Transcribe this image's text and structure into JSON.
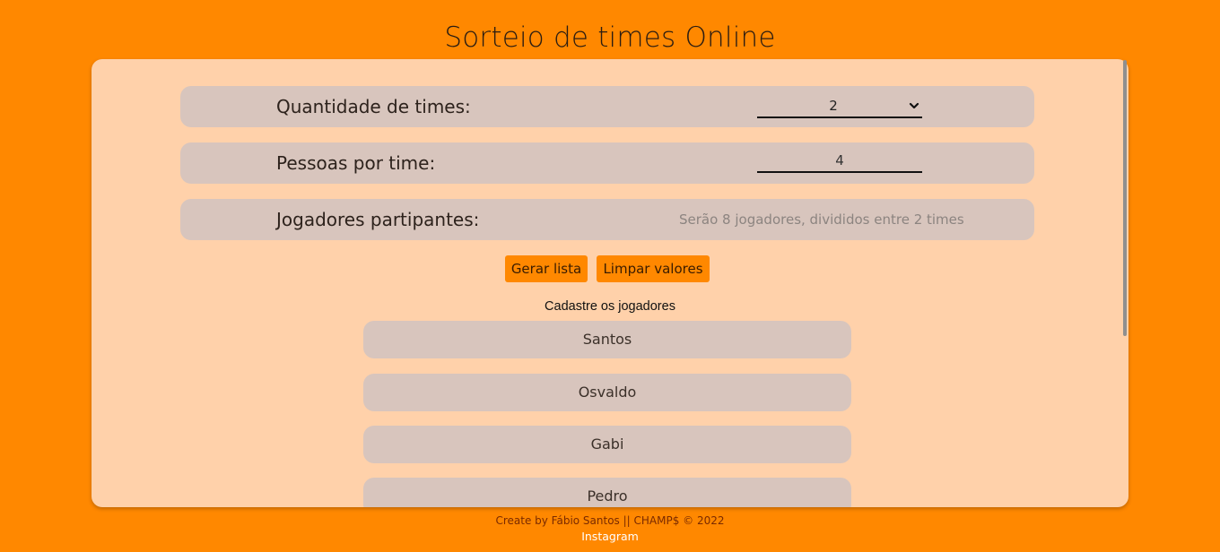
{
  "header": {
    "title": "Sorteio de times Online"
  },
  "form": {
    "teams": {
      "label": "Quantidade de times:",
      "value": "2"
    },
    "per_team": {
      "label": "Pessoas por time:",
      "value": "4"
    },
    "participants": {
      "label": "Jogadores partipantes:",
      "info": "Serão 8 jogadores, divididos entre 2 times"
    }
  },
  "actions": {
    "generate_label": "Gerar lista",
    "clear_label": "Limpar valores"
  },
  "players": {
    "heading": "Cadastre os jogadores",
    "items": [
      "Santos",
      "Osvaldo",
      "Gabi",
      "Pedro"
    ]
  },
  "footer": {
    "credit": "Create by Fábio Santos || CHAMP$ © 2022",
    "link": "Instagram"
  },
  "colors": {
    "background": "#ff8800",
    "panel": "#ffd1aa",
    "field": "#d8c5bd",
    "button": "#ff8800"
  },
  "icons": {
    "select_arrow": "chevron-down-icon"
  }
}
